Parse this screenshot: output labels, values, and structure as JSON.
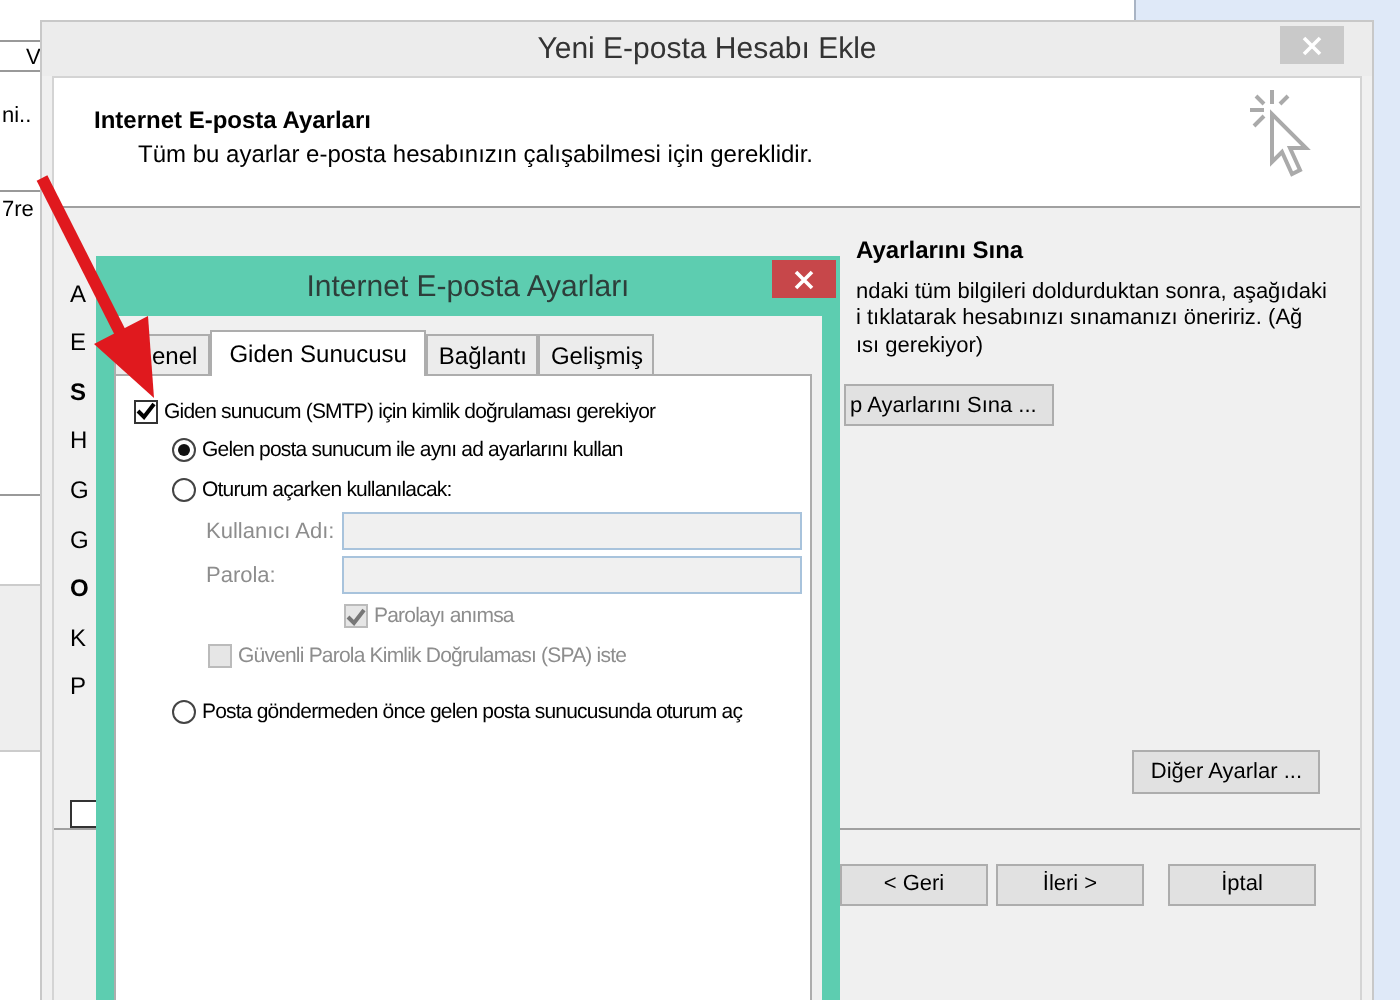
{
  "background_window": {
    "texts": [
      "V",
      "ni..",
      "7re"
    ]
  },
  "dialog": {
    "title": "Yeni E-posta Hesabı Ekle",
    "header": {
      "title": "Internet E-posta Ayarları",
      "subtitle": "Tüm bu ayarlar e-posta hesabınızın çalışabilmesi için gereklidir."
    },
    "left_labels": [
      {
        "text": "A",
        "bold": false
      },
      {
        "text": "E",
        "bold": false
      },
      {
        "text": "S",
        "bold": true
      },
      {
        "text": "H",
        "bold": false
      },
      {
        "text": "G",
        "bold": false
      },
      {
        "text": "G",
        "bold": false
      },
      {
        "text": "O",
        "bold": true
      },
      {
        "text": "K",
        "bold": false
      },
      {
        "text": "P",
        "bold": false
      }
    ],
    "left_checkbox": {
      "checked": false
    },
    "test_section": {
      "heading": "Ayarlarını Sına",
      "lines": [
        "ndaki tüm bilgileri doldurduktan sonra, aşağıdaki",
        "i tıklatarak hesabınızı sınamanızı öneririz. (Ağ",
        "ısı gerekiyor)"
      ],
      "button": "p Ayarlarını Sına ..."
    },
    "more_button": "Diğer Ayarlar ...",
    "buttons": [
      "< Geri",
      "İleri >",
      "İptal"
    ]
  },
  "settings_dialog": {
    "title": "Internet E-posta Ayarları",
    "tabs": [
      {
        "label": "enel",
        "selected": false
      },
      {
        "label": "Giden Sunucusu",
        "selected": true
      },
      {
        "label": "Bağlantı",
        "selected": false
      },
      {
        "label": "Gelişmiş",
        "selected": false
      }
    ],
    "auth_required": {
      "label": "Giden sunucum (SMTP) için kimlik doğrulaması gerekiyor",
      "checked": true
    },
    "options": [
      {
        "label": "Gelen posta sunucum ile aynı ad ayarlarını kullan",
        "selected": true
      },
      {
        "label": "Oturum açarken kullanılacak:",
        "selected": false
      },
      {
        "label": "Posta göndermeden önce gelen posta sunucusunda oturum aç",
        "selected": false
      }
    ],
    "fields": [
      {
        "label": "Kullanıcı Adı:",
        "disabled": true
      },
      {
        "label": "Parola:",
        "disabled": true
      }
    ],
    "remember": {
      "label": "Parolayı anımsa",
      "checked": true,
      "disabled": true
    },
    "spa": {
      "label": "Güvenli Parola Kimlik Doğrulaması (SPA) iste",
      "checked": false,
      "disabled": true
    }
  }
}
